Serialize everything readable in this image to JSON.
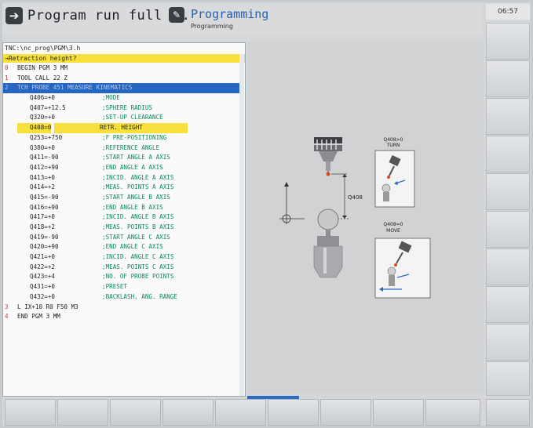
{
  "header": {
    "mode_title": "Program run full s…",
    "programming_title": "Programming",
    "programming_subtitle": "Programming"
  },
  "clock": "06:57",
  "program": {
    "path": "TNC:\\nc_prog\\PGM\\3.h",
    "prompt": "→Retraction height?",
    "lines": [
      {
        "n": "0",
        "text": "BEGIN PGM 3 MM"
      },
      {
        "n": "1",
        "text": "TOOL CALL 22 Z"
      },
      {
        "n": "2",
        "text": "TCH PROBE 451 MEASURE KINEMATICS",
        "selected": true
      },
      {
        "n": "",
        "param": "Q406=+0",
        "comment": ";MODE"
      },
      {
        "n": "",
        "param": "Q407=+12.5",
        "comment": ";SPHERE RADIUS"
      },
      {
        "n": "",
        "param": "Q320=+0",
        "comment": ";SET-UP CLEARANCE"
      },
      {
        "n": "",
        "param": "Q408=0",
        "comment": "RETR. HEIGHT",
        "editing": true
      },
      {
        "n": "",
        "param": "Q253=+750",
        "comment": ";F PRE-POSITIONING"
      },
      {
        "n": "",
        "param": "Q380=+0",
        "comment": ";REFERENCE ANGLE"
      },
      {
        "n": "",
        "param": "Q411=-90",
        "comment": ";START ANGLE A AXIS"
      },
      {
        "n": "",
        "param": "Q412=+90",
        "comment": ";END ANGLE A AXIS"
      },
      {
        "n": "",
        "param": "Q413=+0",
        "comment": ";INCID. ANGLE A AXIS"
      },
      {
        "n": "",
        "param": "Q414=+2",
        "comment": ";MEAS. POINTS A AXIS"
      },
      {
        "n": "",
        "param": "Q415=-90",
        "comment": ";START ANGLE B AXIS"
      },
      {
        "n": "",
        "param": "Q416=+90",
        "comment": ";END ANGLE B AXIS"
      },
      {
        "n": "",
        "param": "Q417=+0",
        "comment": ";INCID. ANGLE B AXIS"
      },
      {
        "n": "",
        "param": "Q418=+2",
        "comment": ";MEAS. POINTS B AXIS"
      },
      {
        "n": "",
        "param": "Q419=-90",
        "comment": ";START ANGLE C AXIS"
      },
      {
        "n": "",
        "param": "Q420=+90",
        "comment": ";END ANGLE C AXIS"
      },
      {
        "n": "",
        "param": "Q421=+0",
        "comment": ";INCID. ANGLE C AXIS"
      },
      {
        "n": "",
        "param": "Q422=+2",
        "comment": ";MEAS. POINTS C AXIS"
      },
      {
        "n": "",
        "param": "Q423=+4",
        "comment": ";NO. OF PROBE POINTS"
      },
      {
        "n": "",
        "param": "Q431=+0",
        "comment": ";PRESET"
      },
      {
        "n": "",
        "param": "Q432=+0",
        "comment": ";BACKLASH, ANG. RANGE"
      },
      {
        "n": "3",
        "text": "L IX+10 R0 F50 M3"
      },
      {
        "n": "4",
        "text": "END PGM 3 MM"
      }
    ]
  },
  "graphic": {
    "q408_label": "Q408",
    "turn_label_1": "Q408>0",
    "turn_label_2": "TURN",
    "move_label_1": "Q408=0",
    "move_label_2": "MOVE"
  },
  "colors": {
    "selection": "#2566c2",
    "edit_highlight": "#f7df3c",
    "comment_green": "#0a8a5a",
    "line_number_red": "#c83c3c"
  }
}
